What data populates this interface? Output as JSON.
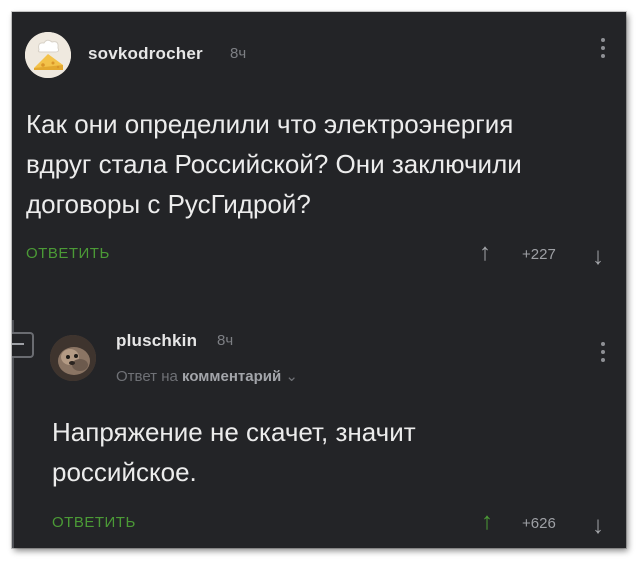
{
  "comments": [
    {
      "username": "sovkodrocher",
      "time": "8ч",
      "text_lines": [
        "Как они определили что электроэнергия",
        "вдруг стала Российской? Они заключили",
        "договоры с РусГидрой?"
      ],
      "reply_label": "ОТВЕТИТЬ",
      "score": "+227",
      "avatar_icon": "chef-cheese-icon"
    },
    {
      "username": "pluschkin",
      "time": "8ч",
      "reply_to_prefix": "Ответ на",
      "reply_to_target": "комментарий",
      "text_lines": [
        "Напряжение не скачет, значит",
        "российское."
      ],
      "reply_label": "ОТВЕТИТЬ",
      "score": "+626",
      "avatar_icon": "animal-photo-icon"
    }
  ],
  "icons": {
    "upvote": "↑",
    "downvote": "↓",
    "chevron": "⌄"
  },
  "colors": {
    "background": "#232427",
    "accent": "#4b9a36",
    "text": "#ececec"
  }
}
